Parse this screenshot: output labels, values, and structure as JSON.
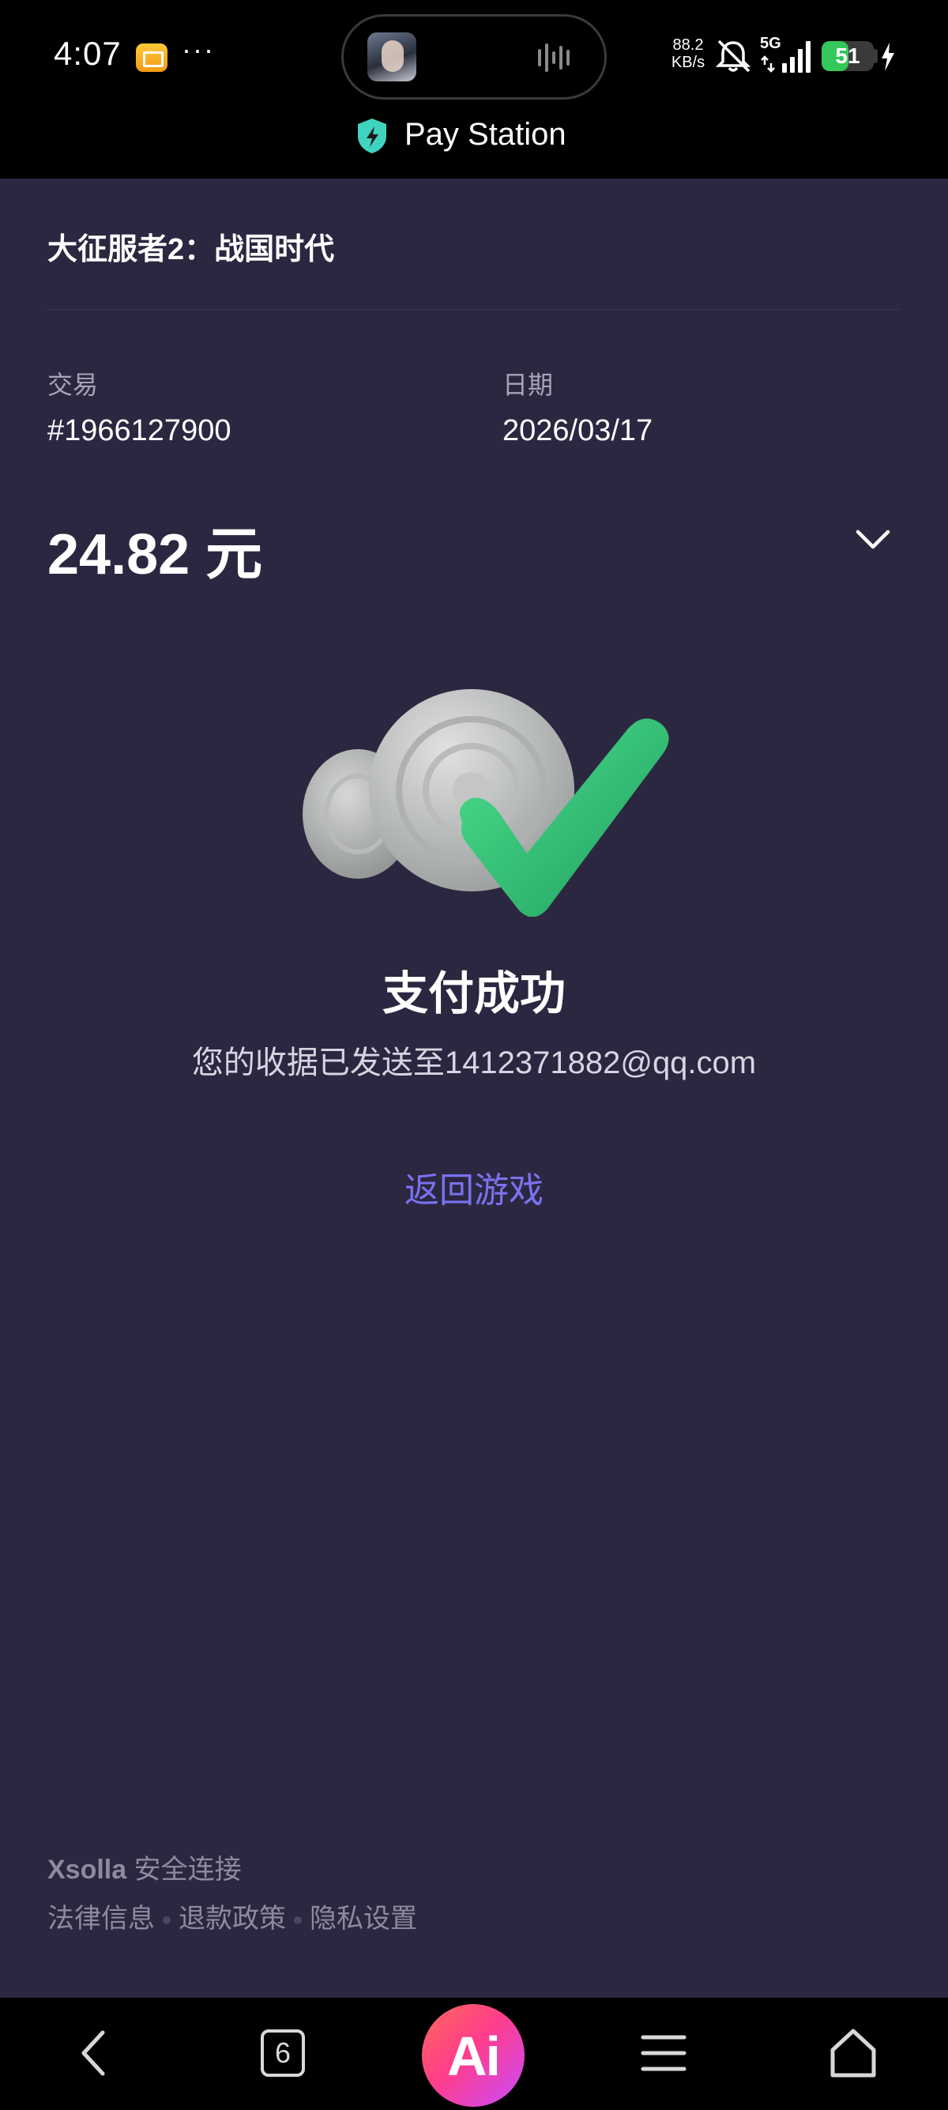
{
  "status_bar": {
    "time": "4:07",
    "more": "···",
    "net_speed_value": "88.2",
    "net_speed_unit": "KB/s",
    "network": "5G",
    "battery": "51",
    "battery_level": 0.51
  },
  "app_header": {
    "title": "Pay Station"
  },
  "order": {
    "game_title": "大征服者2：战国时代",
    "transaction_label": "交易",
    "transaction_value": "#1966127900",
    "date_label": "日期",
    "date_value": "2026/03/17",
    "amount": "24.82 元"
  },
  "success": {
    "title": "支付成功",
    "receipt_text": "您的收据已发送至1412371882@qq.com",
    "back_link": "返回游戏"
  },
  "footer": {
    "brand": "Xsolla",
    "secure_text": "安全连接",
    "links": [
      "法律信息",
      "退款政策",
      "隐私设置"
    ]
  },
  "nav_bar": {
    "tabs_count": "6",
    "ai_label": "Ai"
  },
  "colors": {
    "background": "#2c2740",
    "link": "#7b72f0",
    "check_green": "#2fc47a",
    "shield": "#3fd4c0",
    "battery": "#34c759"
  }
}
